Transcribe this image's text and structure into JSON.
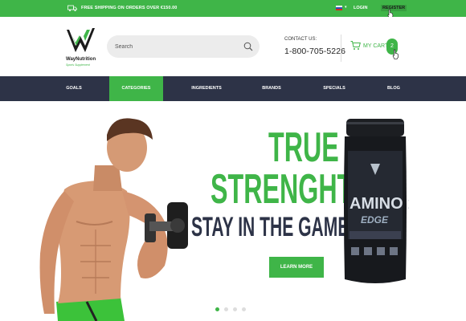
{
  "topbar": {
    "shipping_text": "FREE SHIPPING ON ORDERS OVER €150.00",
    "login": "LOGIN",
    "register": "REGISTER"
  },
  "header": {
    "brand_name": "WayNutrition",
    "brand_tagline": "Sports Supplement",
    "search_placeholder": "Search",
    "contact_label": "CONTACT US:",
    "contact_phone": "1-800-705-5226",
    "cart_label": "MY CART",
    "cart_count": "2"
  },
  "nav": {
    "items": [
      {
        "label": "GOALS"
      },
      {
        "label": "CATEGORIES"
      },
      {
        "label": "INGREDIENTS"
      },
      {
        "label": "BRANDS"
      },
      {
        "label": "SPECIALS"
      },
      {
        "label": "BLOG"
      }
    ],
    "active_index": 1
  },
  "hero": {
    "title_line1": "TRUE",
    "title_line2": "STRENGHT",
    "subtitle": "STAY IN THE GAME",
    "button": "LEARN MORE",
    "product_name": "AMINO x",
    "product_sub": "EDGE",
    "slides": 4,
    "active_slide": 0
  },
  "colors": {
    "accent": "#3fb548",
    "nav_bg": "#2d3347",
    "title_dark": "#2d3347"
  }
}
